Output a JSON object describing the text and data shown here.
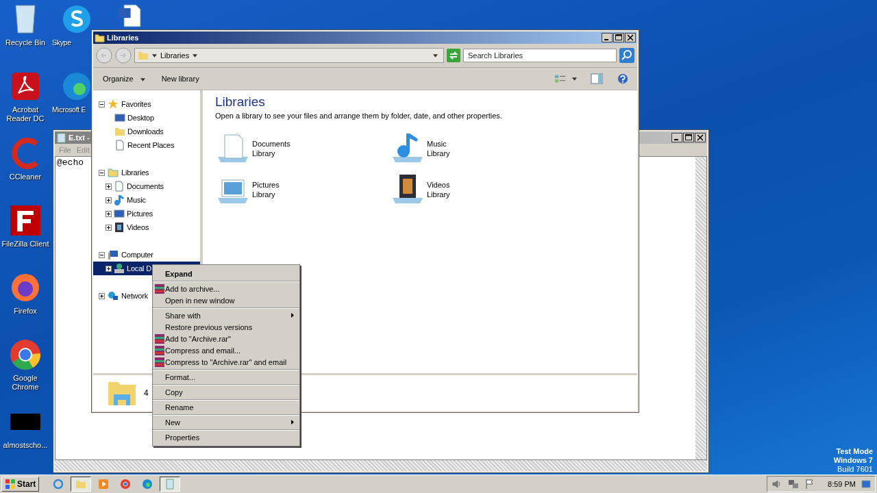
{
  "desktop_columns": [
    [
      {
        "kind": "recycle",
        "label": "Recycle Bin"
      },
      {
        "kind": "acrobat",
        "label": "Acrobat Reader DC"
      },
      {
        "kind": "ccleaner",
        "label": "CCleaner"
      },
      {
        "kind": "filezilla",
        "label": "FileZilla Client"
      },
      {
        "kind": "firefox",
        "label": "Firefox"
      },
      {
        "kind": "chrome",
        "label": "Google Chrome"
      },
      {
        "kind": "black",
        "label": "almostscho..."
      }
    ],
    [
      {
        "kind": "skype",
        "label": "Skype"
      },
      {
        "kind": "edge",
        "label": "Microsoft E"
      }
    ],
    [
      {
        "kind": "word"
      }
    ]
  ],
  "notepad": {
    "title": "E.txt -",
    "menu": [
      "File",
      "Edit"
    ],
    "text": "@echo"
  },
  "explorer": {
    "title": "Libraries",
    "breadcrumb": "Libraries",
    "search": {
      "placeholder": "Search Libraries"
    },
    "toolbar": [
      "Organize",
      "New library"
    ],
    "tree": [
      {
        "kind": "favorites",
        "label": "Favorites",
        "expanded": true,
        "selected": false,
        "children": [
          {
            "kind": "desktop",
            "label": "Desktop",
            "selected": false
          },
          {
            "kind": "downloads",
            "label": "Downloads",
            "selected": false
          },
          {
            "kind": "recent",
            "label": "Recent Places",
            "selected": false
          }
        ]
      },
      {
        "kind": "libraries",
        "label": "Libraries",
        "expanded": true,
        "selected": false,
        "children": [
          {
            "kind": "documents",
            "label": "Documents",
            "expanded": false,
            "selected": false
          },
          {
            "kind": "music",
            "label": "Music",
            "expanded": false,
            "selected": false
          },
          {
            "kind": "pictures",
            "label": "Pictures",
            "expanded": false,
            "selected": false
          },
          {
            "kind": "videos",
            "label": "Videos",
            "expanded": false,
            "selected": false
          }
        ]
      },
      {
        "kind": "computer",
        "label": "Computer",
        "expanded": true,
        "selected": false,
        "children": [
          {
            "kind": "disk",
            "label": "Local D",
            "expanded": false,
            "selected": true
          }
        ]
      },
      {
        "kind": "network",
        "label": "Network",
        "expanded": false,
        "selected": false
      }
    ],
    "heading": "Libraries",
    "description": "Open a library to see your files and arrange them by folder, date, and other properties.",
    "libraries": [
      {
        "kind": "documents",
        "name": "Documents",
        "sub": "Library"
      },
      {
        "kind": "music",
        "name": "Music",
        "sub": "Library"
      },
      {
        "kind": "pictures",
        "name": "Pictures",
        "sub": "Library"
      },
      {
        "kind": "videos",
        "name": "Videos",
        "sub": "Library"
      }
    ],
    "details": "4"
  },
  "context_menu": [
    [
      {
        "label": "Expand",
        "default": true,
        "archive": false,
        "submenu": false
      }
    ],
    [
      {
        "label": "Add to archive...",
        "default": false,
        "archive": true,
        "submenu": false
      },
      {
        "label": "Open in new window",
        "default": false,
        "archive": false,
        "submenu": false
      }
    ],
    [
      {
        "label": "Share with",
        "default": false,
        "archive": false,
        "submenu": true
      },
      {
        "label": "Restore previous versions",
        "default": false,
        "archive": false,
        "submenu": false
      },
      {
        "label": "Add to \"Archive.rar\"",
        "default": false,
        "archive": true,
        "submenu": false
      },
      {
        "label": "Compress and email...",
        "default": false,
        "archive": true,
        "submenu": false
      },
      {
        "label": "Compress to \"Archive.rar\" and email",
        "default": false,
        "archive": true,
        "submenu": false
      }
    ],
    [
      {
        "label": "Format...",
        "default": false,
        "archive": false,
        "submenu": false
      }
    ],
    [
      {
        "label": "Copy",
        "default": false,
        "archive": false,
        "submenu": false
      }
    ],
    [
      {
        "label": "Rename",
        "default": false,
        "archive": false,
        "submenu": false
      }
    ],
    [
      {
        "label": "New",
        "default": false,
        "archive": false,
        "submenu": true
      }
    ],
    [
      {
        "label": "Properties",
        "default": false,
        "archive": false,
        "submenu": false
      }
    ]
  ],
  "test_mode": [
    "Test Mode",
    "Windows 7",
    "Build 7601"
  ],
  "taskbar": {
    "start": "Start",
    "apps": [
      {
        "kind": "ie",
        "selected": false
      },
      {
        "kind": "explorer",
        "selected": true
      },
      {
        "kind": "media",
        "selected": false
      },
      {
        "kind": "chrome",
        "selected": false
      },
      {
        "kind": "edge",
        "selected": false
      },
      {
        "kind": "notepad",
        "selected": true
      }
    ],
    "time": "8:59 PM"
  }
}
